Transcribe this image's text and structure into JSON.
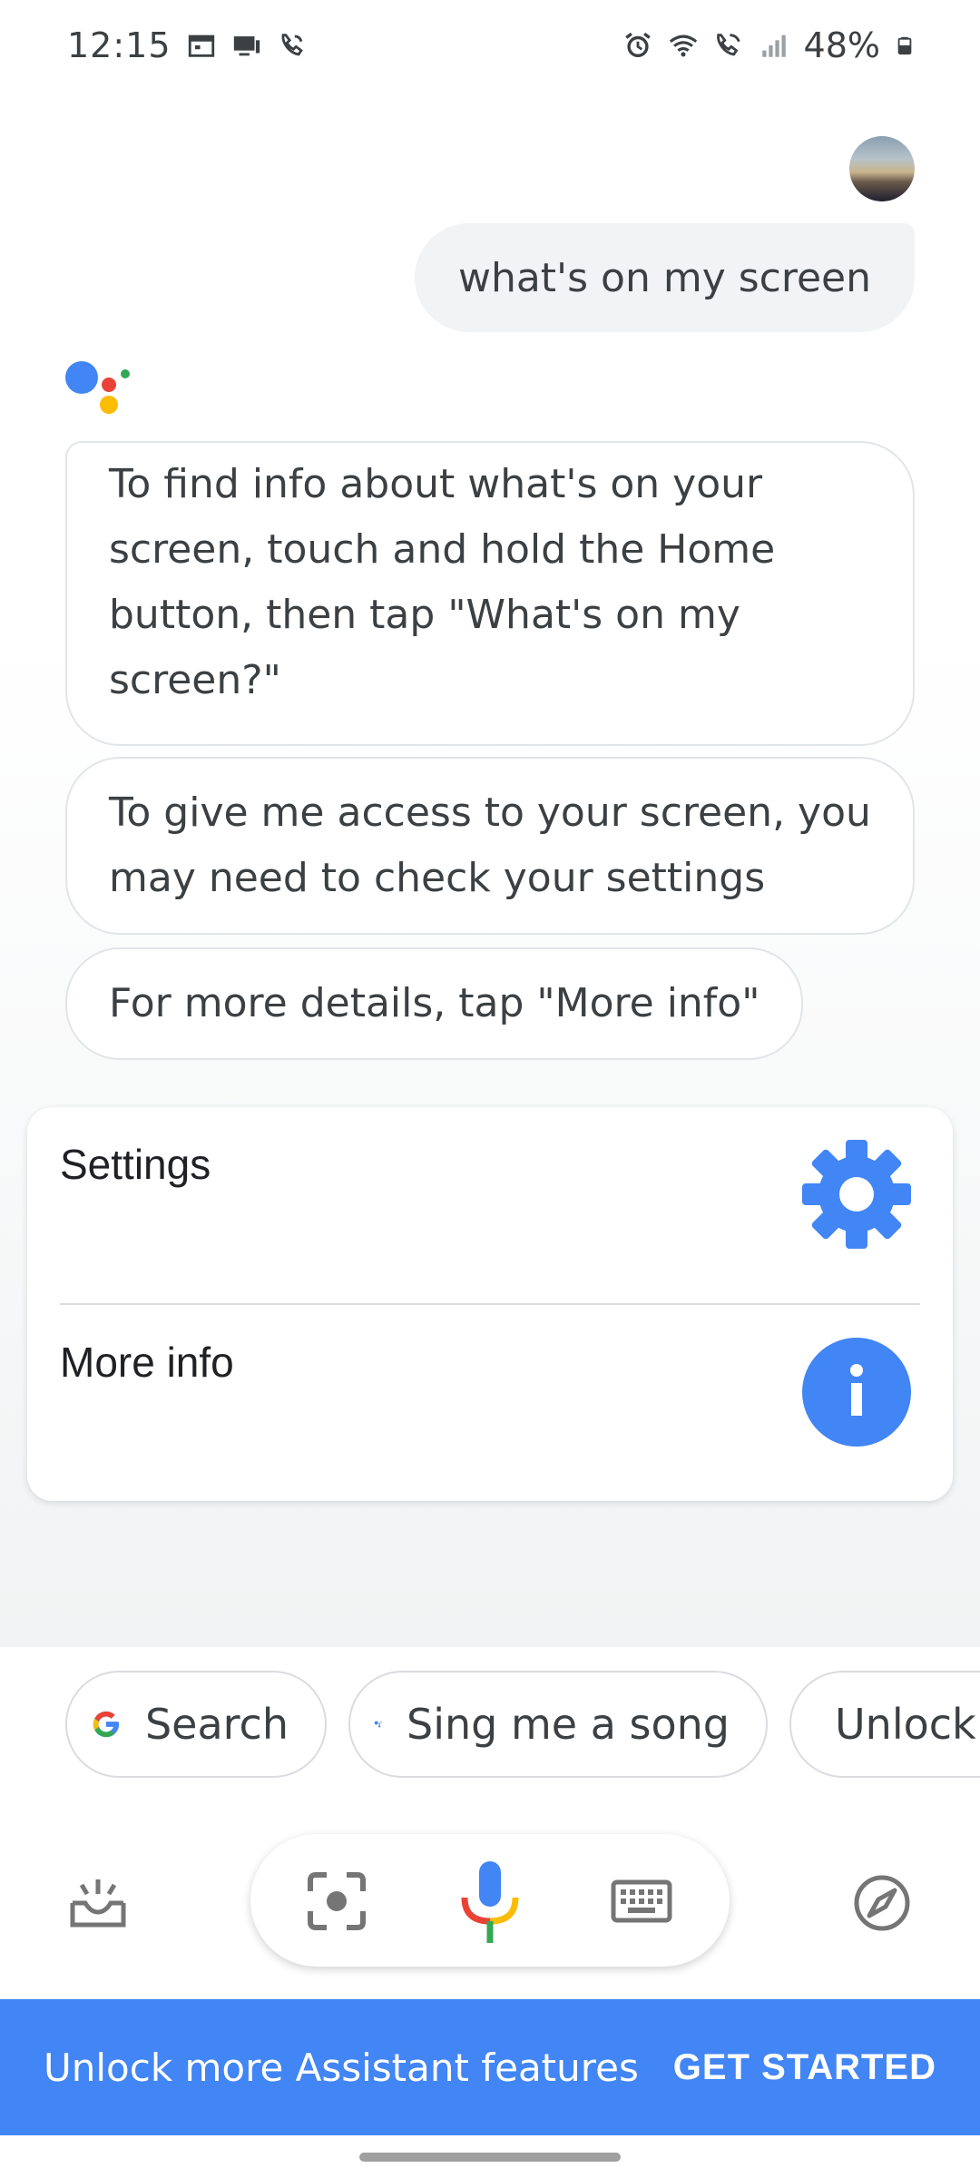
{
  "status_bar": {
    "time": "12:15",
    "battery": "48%",
    "left_icons": [
      "calendar-icon",
      "media-cast-icon",
      "wifi-call-icon"
    ],
    "right_icons": [
      "alarm-icon",
      "wifi-icon",
      "call-signal-icon",
      "signal-bars-icon",
      "battery-icon"
    ]
  },
  "conversation": {
    "user_query": "what's on my screen",
    "responses": [
      "To find info about what's on your screen, touch and hold the Home button, then tap \"What's on my screen?\"",
      "To give me access to your screen, you may need to check your settings",
      "For more details, tap \"More info\""
    ]
  },
  "card": {
    "items": [
      {
        "label": "Settings",
        "icon": "gear-icon"
      },
      {
        "label": "More info",
        "icon": "info-icon"
      }
    ]
  },
  "suggestions": [
    {
      "label": "Search",
      "icon": "google-g-icon"
    },
    {
      "label": "Sing me a song",
      "icon": "assistant-dots-icon"
    },
    {
      "label": "Unlock"
    }
  ],
  "action_bar": {
    "icons": [
      "updates-icon",
      "lens-icon",
      "mic-icon",
      "keyboard-icon",
      "explore-icon"
    ]
  },
  "banner": {
    "text": "Unlock more Assistant features",
    "button": "GET STARTED",
    "color": "#4285f4"
  },
  "colors": {
    "google_blue": "#4285f4",
    "google_red": "#ea4335",
    "google_yellow": "#fbbc04",
    "google_green": "#34a853"
  }
}
